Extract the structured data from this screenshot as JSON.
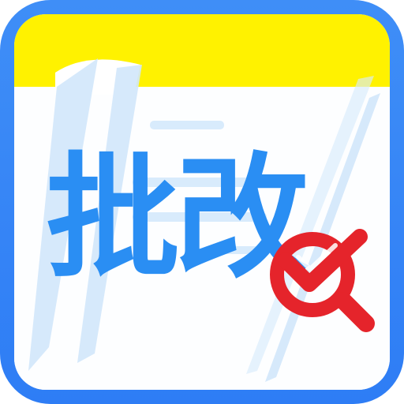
{
  "app_icon": {
    "title": "批改",
    "icon_names": [
      "notebook-icon",
      "red-check-magnifier-icon"
    ],
    "colors": {
      "background_blue": "#2e7df5",
      "header_yellow": "#fff200",
      "paper_white": "#ffffff",
      "text_blue": "#2a8ef3",
      "stripe_light_blue": "#cfe5fb",
      "marker_red": "#e5242b"
    }
  }
}
